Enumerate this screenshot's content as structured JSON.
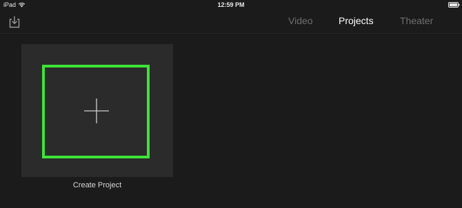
{
  "status_bar": {
    "device": "iPad",
    "time": "12:59 PM",
    "wifi_icon": "wifi-icon",
    "battery_icon": "battery-icon"
  },
  "toolbar": {
    "import_icon": "import-icon",
    "tabs": [
      {
        "label": "Video",
        "active": false
      },
      {
        "label": "Projects",
        "active": true
      },
      {
        "label": "Theater",
        "active": false
      }
    ]
  },
  "content": {
    "create_project_label": "Create Project",
    "plus_icon": "plus-icon",
    "highlight_color": "#3ee338"
  }
}
